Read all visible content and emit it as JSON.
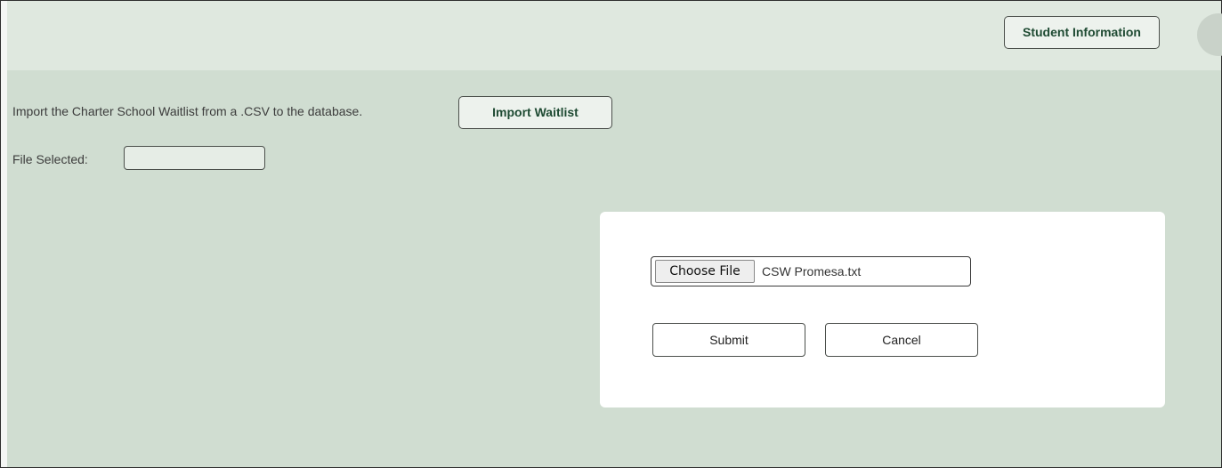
{
  "header": {
    "student_info_label": "Student Information"
  },
  "import_section": {
    "description": "Import the Charter School Waitlist from a .CSV to the database.",
    "import_button_label": "Import Waitlist",
    "file_selected_label": "File Selected:",
    "file_selected_value": ""
  },
  "dialog": {
    "choose_file_label": "Choose File",
    "chosen_file_name": "CSW Promesa.txt",
    "submit_label": "Submit",
    "cancel_label": "Cancel"
  },
  "colors": {
    "page_background": "#d0ddd1",
    "header_background": "#dfe8df",
    "accent_text": "#1e4a32",
    "dialog_background": "#ffffff"
  }
}
